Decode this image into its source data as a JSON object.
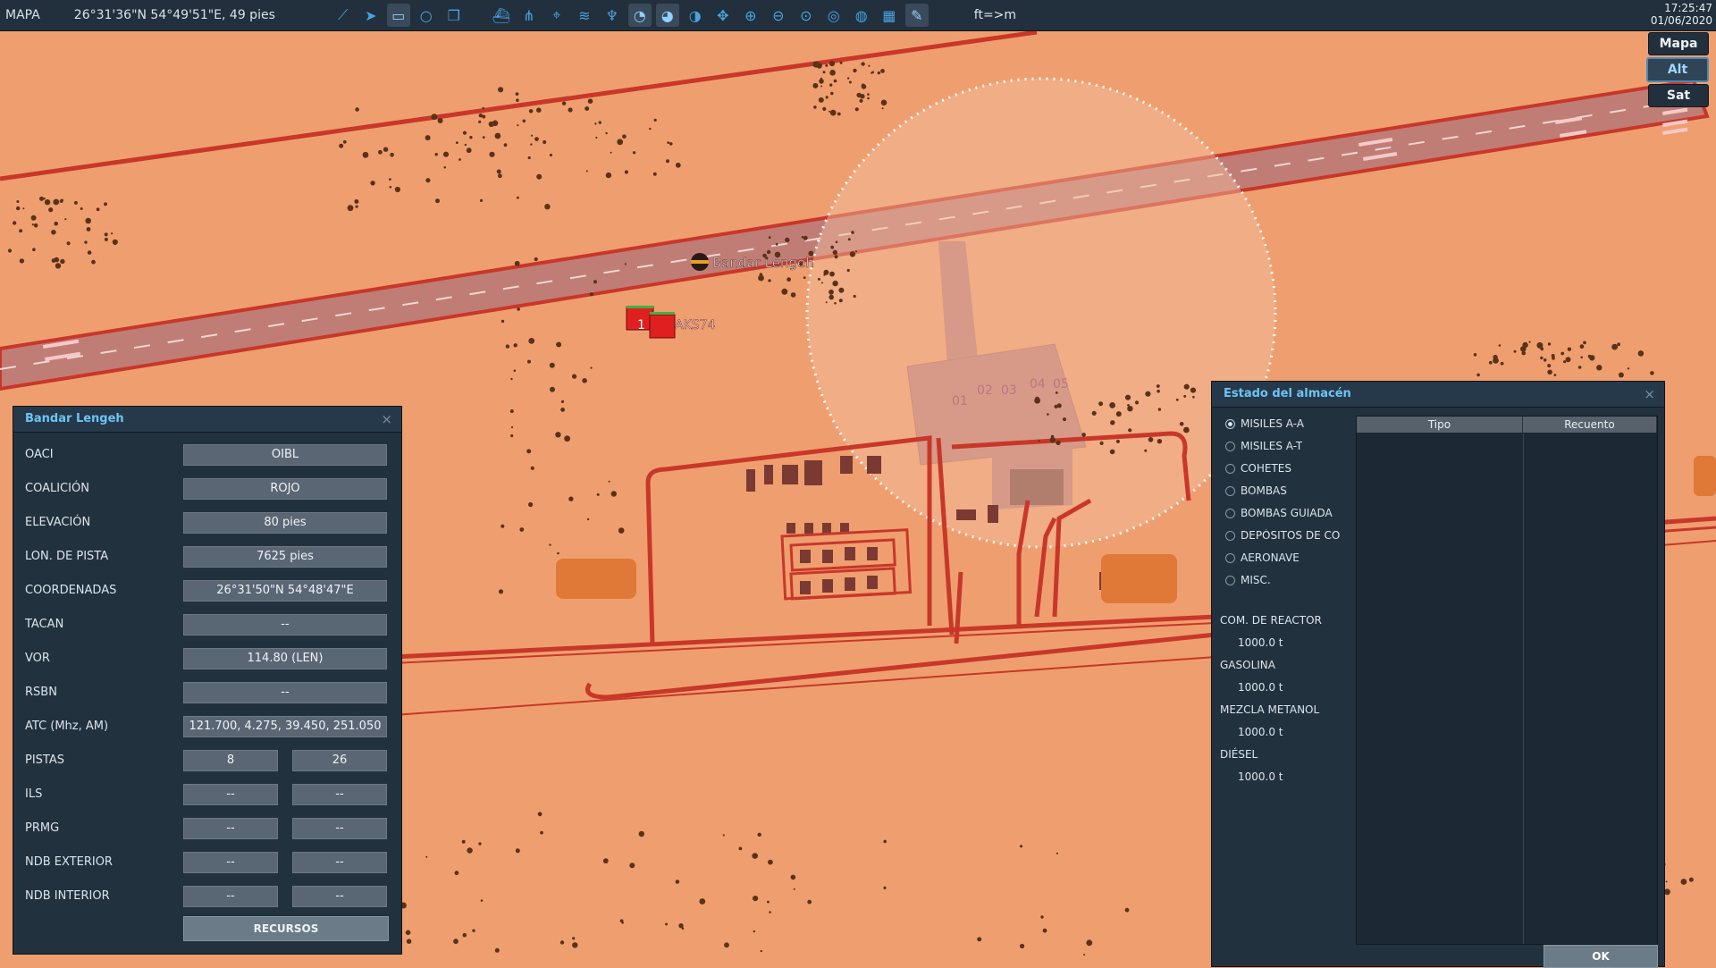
{
  "topbar": {
    "mode": "MAPA",
    "coords": "26°31'36\"N 54°49'51\"E, 49 pies",
    "tools": [
      "route-icon",
      "arrow-icon",
      "ruler-icon",
      "circle-icon",
      "layers-icon",
      "ship-icon",
      "network-icon",
      "crosshair-icon",
      "signal-icon",
      "tower-icon",
      "radar1-icon",
      "radar2-icon",
      "radar3-icon",
      "pan-icon",
      "zoom-in-icon",
      "zoom-out-icon",
      "zoom-fit-icon",
      "target-icon",
      "globe-icon",
      "grid-icon",
      "pencil-icon"
    ],
    "units": "ft=>m",
    "time": "17:25:47",
    "date": "01/06/2020"
  },
  "layers": {
    "map": "Mapa",
    "alt": "Alt",
    "sat": "Sat"
  },
  "map": {
    "airfield_label": "Bandar Lengeh",
    "unit_label": "AKS74",
    "unit_number": "1",
    "parking": [
      "01",
      "02",
      "03",
      "04",
      "05"
    ]
  },
  "airfield_panel": {
    "title": "Bandar Lengeh",
    "close": "×",
    "rows": [
      {
        "label": "OACI",
        "value": "OIBL"
      },
      {
        "label": "COALICIÓN",
        "value": "ROJO"
      },
      {
        "label": "ELEVACIÓN",
        "value": "80 pies"
      },
      {
        "label": "LON. DE PISTA",
        "value": "7625 pies"
      },
      {
        "label": "COORDENADAS",
        "value": "26°31'50\"N 54°48'47\"E"
      },
      {
        "label": "TACAN",
        "value": "--"
      },
      {
        "label": "VOR",
        "value": "114.80 (LEN)"
      },
      {
        "label": "RSBN",
        "value": "--"
      },
      {
        "label": "ATC  (Mhz, AM)",
        "value": "121.700, 4.275, 39.450, 251.050"
      }
    ],
    "pair_rows": [
      {
        "label": "PISTAS",
        "left": "8",
        "right": "26"
      },
      {
        "label": "ILS",
        "left": "--",
        "right": "--"
      },
      {
        "label": "PRMG",
        "left": "--",
        "right": "--"
      },
      {
        "label": "NDB EXTERIOR",
        "left": "--",
        "right": "--"
      },
      {
        "label": "NDB INTERIOR",
        "left": "--",
        "right": "--"
      }
    ],
    "resources_button": "RECURSOS"
  },
  "warehouse_panel": {
    "title": "Estado del almacén",
    "close": "×",
    "categories": [
      "MISILES A-A",
      "MISILES A-T",
      "COHETES",
      "BOMBAS",
      "BOMBAS GUIADA",
      "DEPÓSITOS DE CO",
      "AERONAVE",
      "MISC."
    ],
    "selected_category": "MISILES A-A",
    "table_headers": [
      "Tipo",
      "Recuento"
    ],
    "fuels": [
      {
        "label": "COM. DE REACTOR",
        "value": "1000.0 t"
      },
      {
        "label": "GASOLINA",
        "value": "1000.0 t"
      },
      {
        "label": "MEZCLA METANOL",
        "value": "1000.0 t"
      },
      {
        "label": "DIÉSEL",
        "value": "1000.0 t"
      }
    ],
    "ok_button": "OK"
  }
}
